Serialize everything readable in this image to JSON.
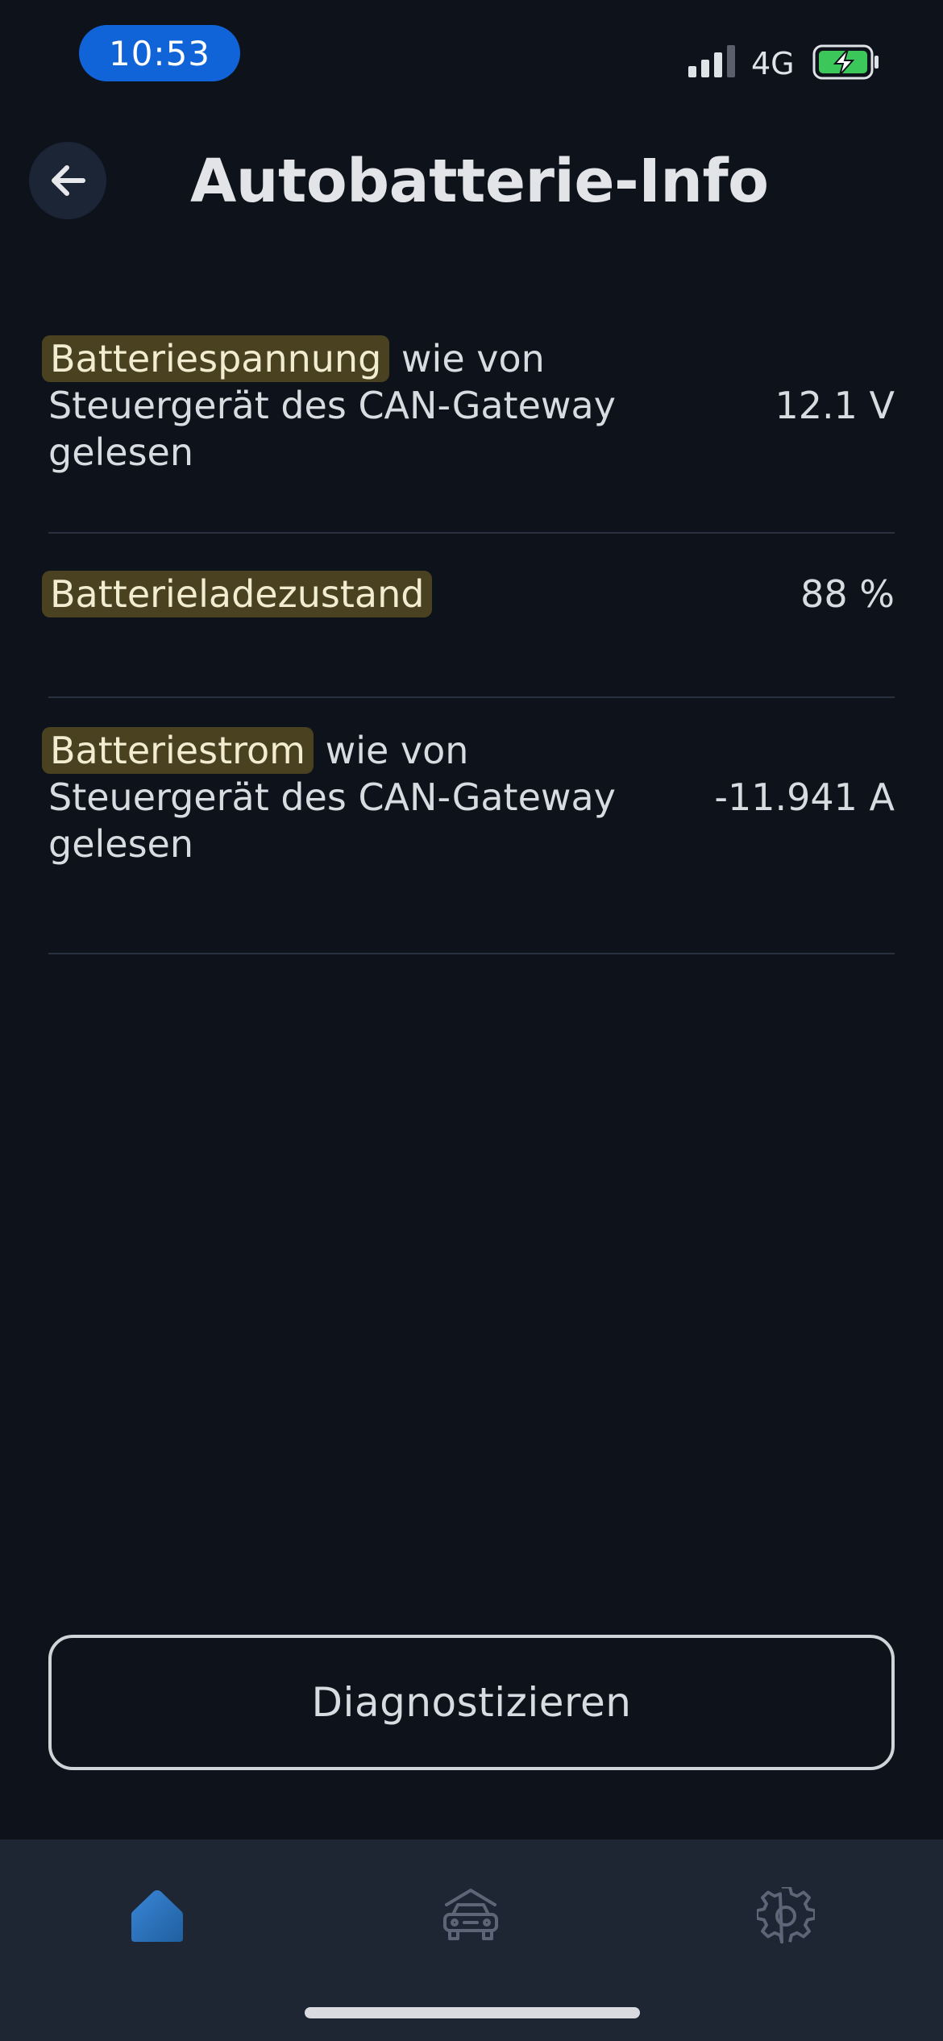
{
  "status_bar": {
    "time": "10:53",
    "network": "4G",
    "signal_icon": "signal-bars-icon",
    "battery_icon": "battery-charging-icon",
    "battery_color": "#3cc75a"
  },
  "header": {
    "title": "Autobatterie-Info",
    "back_icon": "arrow-left-icon"
  },
  "info_rows": [
    {
      "highlight": "Batteriespannung",
      "rest": " wie von Steuergerät des CAN-Gateway gelesen",
      "value": "12.1 V"
    },
    {
      "highlight": "Batterieladezustand",
      "rest": "",
      "value": "88 %"
    },
    {
      "highlight": "Batteriestrom",
      "rest": " wie von Steuergerät des CAN-Gateway gelesen",
      "value": "-11.941 A"
    }
  ],
  "actions": {
    "diagnose_label": "Diagnostizieren"
  },
  "tab_bar": {
    "tabs": [
      {
        "icon": "home-icon",
        "active": true
      },
      {
        "icon": "car-icon",
        "active": false
      },
      {
        "icon": "gear-icon",
        "active": false
      }
    ]
  },
  "colors": {
    "background": "#0e121b",
    "accent": "#1064d8",
    "highlight": "#4a4120",
    "tab_bar": "#1e2533"
  }
}
